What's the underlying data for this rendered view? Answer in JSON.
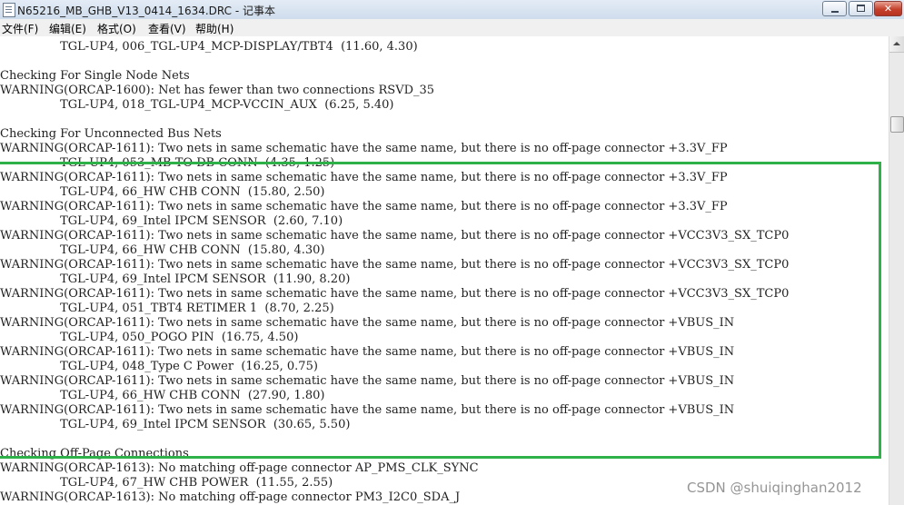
{
  "window": {
    "title": "N65216_MB_GHB_V13_0414_1634.DRC - 记事本",
    "close_symbol": "✕"
  },
  "menu": {
    "items": [
      "文件(F)",
      "编辑(E)",
      "格式(O)",
      "查看(V)",
      "帮助(H)"
    ]
  },
  "editor": {
    "lines": [
      "                TGL-UP4, 006_TGL-UP4_MCP-DISPLAY/TBT4  (11.60, 4.30)",
      "",
      "Checking For Single Node Nets",
      "WARNING(ORCAP-1600): Net has fewer than two connections RSVD_35",
      "                TGL-UP4, 018_TGL-UP4_MCP-VCCIN_AUX  (6.25, 5.40)",
      "",
      "Checking For Unconnected Bus Nets",
      "WARNING(ORCAP-1611): Two nets in same schematic have the same name, but there is no off-page connector +3.3V_FP",
      "                TGL-UP4, 053_MB TO DB CONN  (4.35, 1.25)",
      "WARNING(ORCAP-1611): Two nets in same schematic have the same name, but there is no off-page connector +3.3V_FP",
      "                TGL-UP4, 66_HW CHB CONN  (15.80, 2.50)",
      "WARNING(ORCAP-1611): Two nets in same schematic have the same name, but there is no off-page connector +3.3V_FP",
      "                TGL-UP4, 69_Intel IPCM SENSOR  (2.60, 7.10)",
      "WARNING(ORCAP-1611): Two nets in same schematic have the same name, but there is no off-page connector +VCC3V3_SX_TCP0",
      "                TGL-UP4, 66_HW CHB CONN  (15.80, 4.30)",
      "WARNING(ORCAP-1611): Two nets in same schematic have the same name, but there is no off-page connector +VCC3V3_SX_TCP0",
      "                TGL-UP4, 69_Intel IPCM SENSOR  (11.90, 8.20)",
      "WARNING(ORCAP-1611): Two nets in same schematic have the same name, but there is no off-page connector +VCC3V3_SX_TCP0",
      "                TGL-UP4, 051_TBT4 RETIMER 1  (8.70, 2.25)",
      "WARNING(ORCAP-1611): Two nets in same schematic have the same name, but there is no off-page connector +VBUS_IN",
      "                TGL-UP4, 050_POGO PIN  (16.75, 4.50)",
      "WARNING(ORCAP-1611): Two nets in same schematic have the same name, but there is no off-page connector +VBUS_IN",
      "                TGL-UP4, 048_Type C Power  (16.25, 0.75)",
      "WARNING(ORCAP-1611): Two nets in same schematic have the same name, but there is no off-page connector +VBUS_IN",
      "                TGL-UP4, 66_HW CHB CONN  (27.90, 1.80)",
      "WARNING(ORCAP-1611): Two nets in same schematic have the same name, but there is no off-page connector +VBUS_IN",
      "                TGL-UP4, 69_Intel IPCM SENSOR  (30.65, 5.50)",
      "",
      "Checking Off-Page Connections",
      "WARNING(ORCAP-1613): No matching off-page connector AP_PMS_CLK_SYNC",
      "                TGL-UP4, 67_HW CHB POWER  (11.55, 2.55)",
      "WARNING(ORCAP-1613): No matching off-page connector PM3_I2C0_SDA_J"
    ]
  },
  "watermark": {
    "text": "CSDN @shuiqinghan2012"
  },
  "colors": {
    "highlight_box": "#2fb14a"
  }
}
